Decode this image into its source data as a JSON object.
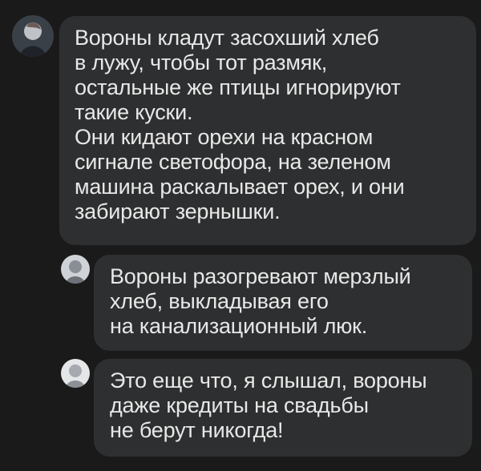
{
  "thread": {
    "messages": [
      {
        "lines": [
          "Вороны кладут засохший хлеб",
          "в лужу, чтобы тот размяк,",
          "остальные же птицы игнорируют",
          "такие куски.",
          "Они кидают орехи на красном",
          "сигнале светофора, на зеленом",
          "машина раскалывает орех, и они",
          "забирают зернышки."
        ]
      },
      {
        "lines": [
          "Вороны разогревают мерзлый",
          "хлеб, выкладывая его",
          "на канализационный люк."
        ]
      },
      {
        "lines": [
          "Это еще что, я слышал, вороны",
          "даже кредиты на свадьбы",
          "не берут никогда!"
        ]
      }
    ]
  },
  "colors": {
    "background": "#1a1a1a",
    "bubble": "#2e2f30",
    "text": "#e8e8e8"
  }
}
